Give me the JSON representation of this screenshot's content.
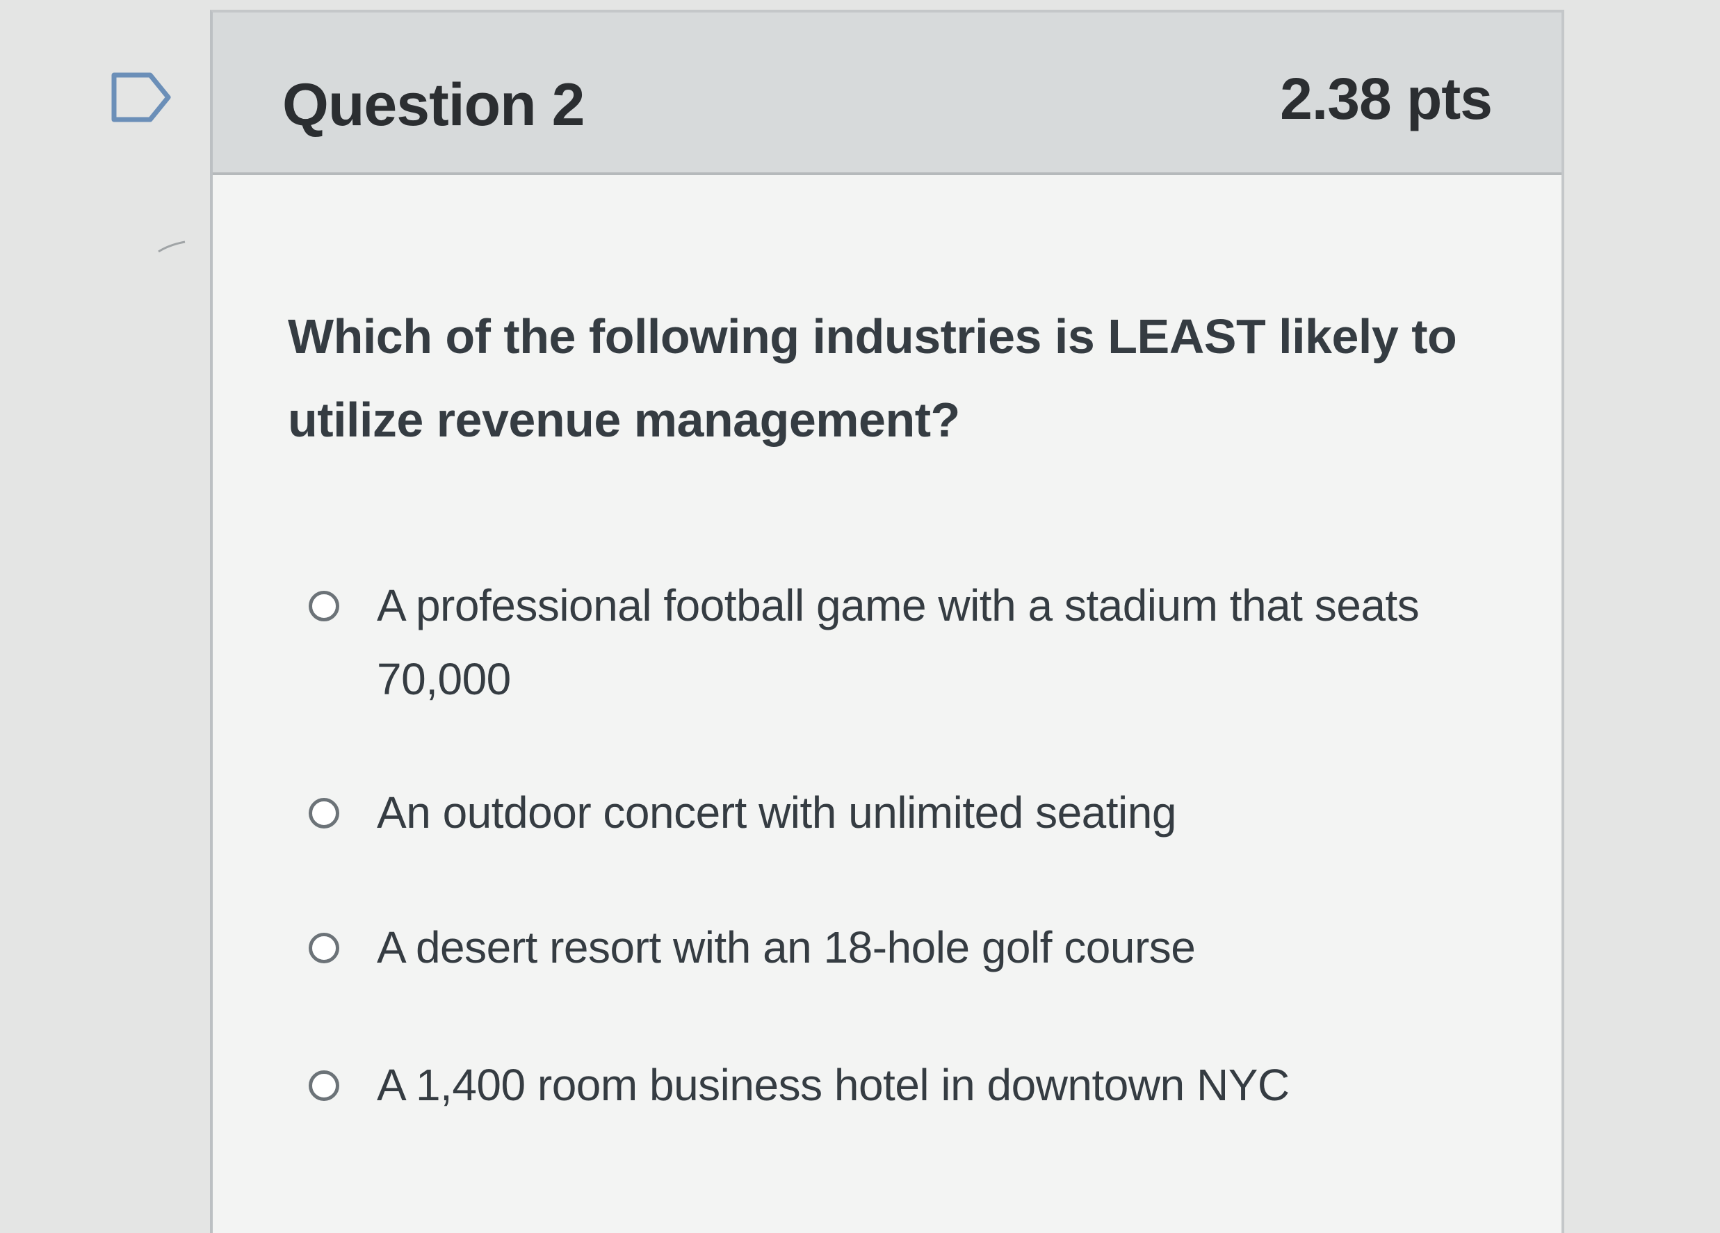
{
  "question": {
    "title": "Question 2",
    "points": "2.38 pts",
    "flag_icon": "flag-icon",
    "text": "Which of the following industries is LEAST likely to utilize revenue management?"
  },
  "answers": [
    {
      "label": "A professional football game with a stadium that seats 70,000",
      "selected": false
    },
    {
      "label": "An outdoor concert with unlimited seating",
      "selected": false
    },
    {
      "label": "A desert resort with an 18-hole golf course",
      "selected": false
    },
    {
      "label": "A 1,400 room business hotel in downtown NYC",
      "selected": false
    }
  ],
  "colors": {
    "page_background": "#e4e5e4",
    "header_background": "#d7dadb",
    "card_background": "#f3f4f3",
    "text": "#2d3b45",
    "flag_icon": "#6b8fb8"
  }
}
